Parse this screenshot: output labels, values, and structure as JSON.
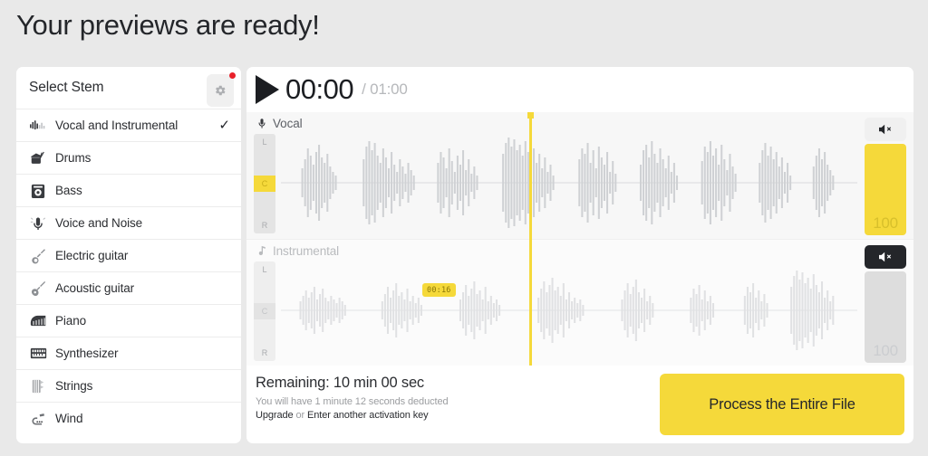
{
  "page": {
    "title": "Your previews are ready!"
  },
  "sidebar": {
    "title": "Select Stem",
    "settings_icon": "gear-icon",
    "has_notification_dot": true,
    "items": [
      {
        "label": "Vocal and Instrumental",
        "icon": "waveform-icon",
        "selected": true
      },
      {
        "label": "Drums",
        "icon": "drums-icon",
        "selected": false
      },
      {
        "label": "Bass",
        "icon": "bass-amp-icon",
        "selected": false
      },
      {
        "label": "Voice and Noise",
        "icon": "microphone-icon",
        "selected": false
      },
      {
        "label": "Electric guitar",
        "icon": "electric-guitar-icon",
        "selected": false
      },
      {
        "label": "Acoustic guitar",
        "icon": "acoustic-guitar-icon",
        "selected": false
      },
      {
        "label": "Piano",
        "icon": "piano-icon",
        "selected": false
      },
      {
        "label": "Synthesizer",
        "icon": "synthesizer-icon",
        "selected": false
      },
      {
        "label": "Strings",
        "icon": "strings-icon",
        "selected": false
      },
      {
        "label": "Wind",
        "icon": "wind-instrument-icon",
        "selected": false
      }
    ],
    "check_glyph": "✓"
  },
  "player": {
    "play_icon": "play-icon",
    "current_time": "00:00",
    "total_time": "/ 01:00"
  },
  "tracks": [
    {
      "name": "Vocal",
      "icon": "microphone-icon",
      "pan_top_label": "L",
      "pan_bottom_label": "R",
      "pan_value": "C",
      "volume": "100",
      "muted": false,
      "mute_icon": "speaker-mute-icon"
    },
    {
      "name": "Instrumental",
      "icon": "music-note-icon",
      "pan_top_label": "L",
      "pan_bottom_label": "R",
      "pan_value": "C",
      "volume": "100",
      "muted": true,
      "mute_icon": "speaker-mute-icon"
    }
  ],
  "timeline": {
    "hover_tooltip": "00:16"
  },
  "footer": {
    "remaining": "Remaining: 10 min 00 sec",
    "deduction_note": "You will have 1 minute 12 seconds deducted",
    "upgrade_link": "Upgrade",
    "or_text": " or ",
    "activation_link": "Enter another activation key",
    "process_button": "Process the Entire File"
  },
  "colors": {
    "accent_yellow": "#f5d93a",
    "page_bg": "#e9e9e9",
    "panel_bg": "#ffffff",
    "dark": "#24262a",
    "notification_red": "#e8202a"
  }
}
